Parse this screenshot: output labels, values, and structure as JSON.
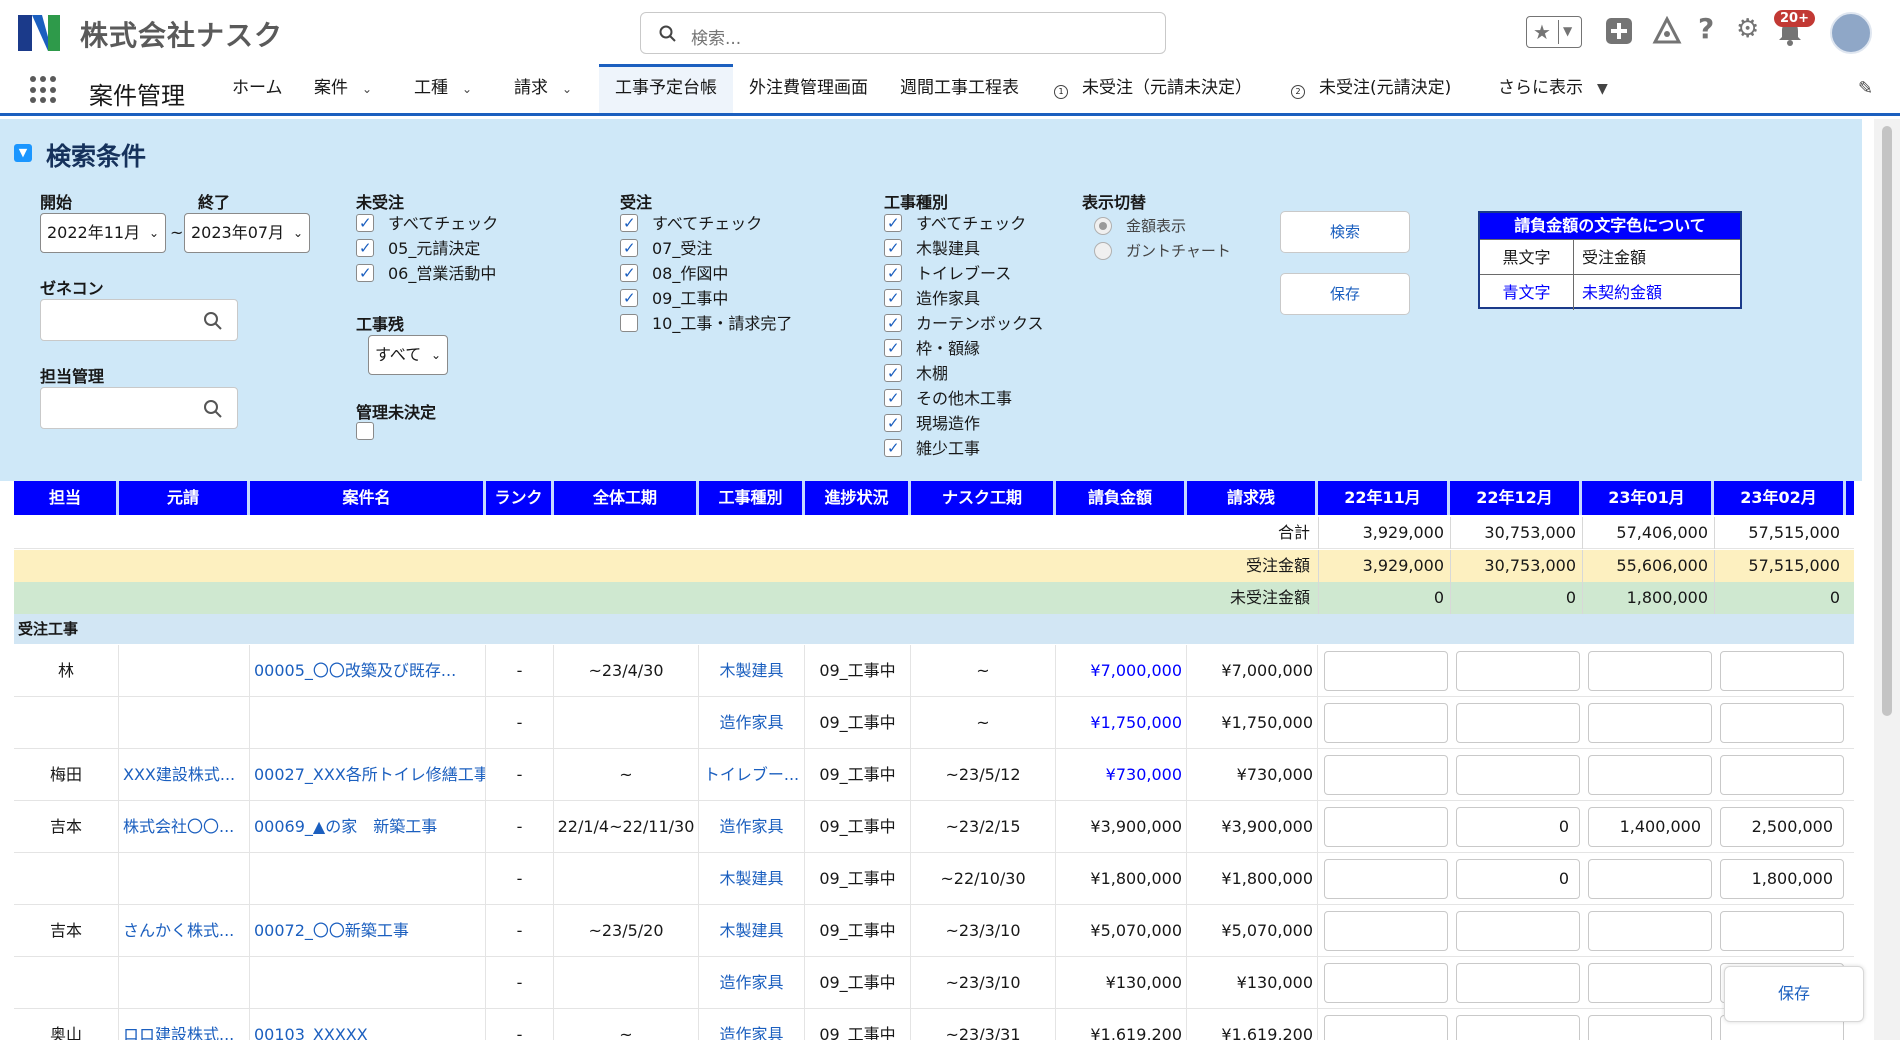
{
  "header": {
    "company": "株式会社ナスク",
    "search_placeholder": "検索...",
    "notifications": "20+"
  },
  "nav": {
    "app": "案件管理",
    "items": [
      {
        "label": "ホーム"
      },
      {
        "label": "案件"
      },
      {
        "label": "工種"
      },
      {
        "label": "請求"
      },
      {
        "label": "工事予定台帳"
      },
      {
        "label": "外注費管理画面"
      },
      {
        "label": "週間工事工程表"
      },
      {
        "label": "未受注（元請未決定）"
      },
      {
        "label": "未受注(元請決定)"
      },
      {
        "label": "さらに表示"
      }
    ]
  },
  "filters": {
    "title": "検索条件",
    "start_label": "開始",
    "end_label": "終了",
    "start_value": "2022年11月",
    "end_value": "2023年07月",
    "range_sep": "~",
    "zenecon_label": "ゼネコン",
    "tanto_label": "担当管理",
    "mijuchu_label": "未受注",
    "mijuchu": [
      "すべてチェック",
      "05_元請決定",
      "06_営業活動中"
    ],
    "kojizan_label": "工事残",
    "kojizan_value": "すべて",
    "kanri_label": "管理未決定",
    "juchu_label": "受注",
    "juchu": [
      "すべてチェック",
      "07_受注",
      "08_作図中",
      "09_工事中",
      "10_工事・請求完了"
    ],
    "koji_label": "工事種別",
    "koji": [
      "すべてチェック",
      "木製建具",
      "トイレブース",
      "造作家具",
      "カーテンボックス",
      "枠・額縁",
      "木棚",
      "その他木工事",
      "現場造作",
      "雑少工事"
    ],
    "display_label": "表示切替",
    "display_options": [
      "金額表示",
      "ガントチャート"
    ],
    "search_button": "検索",
    "save_button": "保存"
  },
  "legend": {
    "title": "請負金額の文字色について",
    "row1": [
      "黒文字",
      "受注金額"
    ],
    "row2": [
      "青文字",
      "未契約金額"
    ]
  },
  "table": {
    "headers": [
      "担当",
      "元請",
      "案件名",
      "ランク",
      "全体工期",
      "工事種別",
      "進捗状況",
      "ナスク工期",
      "請負金額",
      "請求残",
      "22年11月",
      "22年12月",
      "23年01月",
      "23年02月"
    ],
    "sum_rows": [
      {
        "label": "合計",
        "values": [
          "3,929,000",
          "30,753,000",
          "57,406,000",
          "57,515,000"
        ]
      },
      {
        "label": "受注金額",
        "values": [
          "3,929,000",
          "30,753,000",
          "55,606,000",
          "57,515,000"
        ]
      },
      {
        "label": "未受注金額",
        "values": [
          "0",
          "0",
          "1,800,000",
          "0"
        ]
      }
    ],
    "group": "受注工事",
    "rows": [
      {
        "tanto": "林",
        "moto": "",
        "name": "00005_〇〇改築及び既存...",
        "rank": "-",
        "period": "~23/4/30",
        "kind": "木製建具",
        "status": "09_工事中",
        "nask": "~",
        "amount": "¥7,000,000",
        "remain": "¥7,000,000",
        "m": [
          "",
          "",
          "",
          ""
        ]
      },
      {
        "tanto": "",
        "moto": "",
        "name": "",
        "rank": "-",
        "period": "",
        "kind": "造作家具",
        "status": "09_工事中",
        "nask": "~",
        "amount": "¥1,750,000",
        "remain": "¥1,750,000",
        "m": [
          "",
          "",
          "",
          ""
        ]
      },
      {
        "tanto": "梅田",
        "moto": "XXX建設株式...",
        "name": "00027_XXX各所トイレ修繕工事",
        "rank": "-",
        "period": "~",
        "kind": "トイレブー...",
        "status": "09_工事中",
        "nask": "~23/5/12",
        "amount": "¥730,000",
        "remain": "¥730,000",
        "m": [
          "",
          "",
          "",
          ""
        ]
      },
      {
        "tanto": "吉本",
        "moto": "株式会社〇〇...",
        "name": "00069_▲の家　新築工事",
        "rank": "-",
        "period": "22/1/4~22/11/30",
        "kind": "造作家具",
        "status": "09_工事中",
        "nask": "~23/2/15",
        "amount": "¥3,900,000",
        "remain": "¥3,900,000",
        "m": [
          "",
          "0",
          "1,400,000",
          "2,500,000"
        ]
      },
      {
        "tanto": "",
        "moto": "",
        "name": "",
        "rank": "-",
        "period": "",
        "kind": "木製建具",
        "status": "09_工事中",
        "nask": "~22/10/30",
        "amount": "¥1,800,000",
        "remain": "¥1,800,000",
        "m": [
          "",
          "0",
          "",
          "1,800,000"
        ]
      },
      {
        "tanto": "吉本",
        "moto": "さんかく株式...",
        "name": "00072_〇〇新築工事",
        "rank": "-",
        "period": "~23/5/20",
        "kind": "木製建具",
        "status": "09_工事中",
        "nask": "~23/3/10",
        "amount": "¥5,070,000",
        "remain": "¥5,070,000",
        "m": [
          "",
          "",
          "",
          ""
        ]
      },
      {
        "tanto": "",
        "moto": "",
        "name": "",
        "rank": "-",
        "period": "",
        "kind": "造作家具",
        "status": "09_工事中",
        "nask": "~23/3/10",
        "amount": "¥130,000",
        "remain": "¥130,000",
        "m": [
          "",
          "",
          "",
          ""
        ]
      },
      {
        "tanto": "奥山",
        "moto": "ロロ建設株式...",
        "name": "00103_XXXXX",
        "rank": "-",
        "period": "~",
        "kind": "造作家具",
        "status": "09_工事中",
        "nask": "~23/3/31",
        "amount": "¥1,619,200",
        "remain": "¥1,619,200",
        "m": [
          "",
          "",
          "",
          ""
        ]
      }
    ],
    "blue_amount_rows": [
      0,
      1,
      2
    ],
    "float_save": "保存"
  },
  "colors": {
    "accent": "#1b5fbf",
    "header_blue": "#0000ff",
    "panel": "#cfe8f8",
    "yellow": "#fdf0c0",
    "green": "#cfe8d0"
  }
}
